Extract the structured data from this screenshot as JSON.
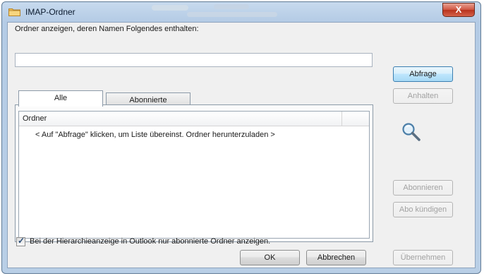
{
  "window": {
    "title": "IMAP-Ordner",
    "close_label": "X"
  },
  "filter": {
    "label": "Ordner anzeigen, deren Namen Folgendes enthalten:",
    "value": "",
    "placeholder": ""
  },
  "tabs": [
    {
      "label": "Alle",
      "active": true
    },
    {
      "label": "Abonnierte",
      "active": false
    }
  ],
  "list": {
    "column_header": "Ordner",
    "empty_message": "< Auf \"Abfrage\" klicken, um Liste übereinst. Ordner herunterzuladen >"
  },
  "side_buttons": {
    "query": "Abfrage",
    "stop": "Anhalten",
    "subscribe": "Abonnieren",
    "unsubscribe": "Abo kündigen"
  },
  "hierarchy_option": {
    "label": "Bei der Hierarchieanzeige in Outlook nur abonnierte Ordner anzeigen.",
    "checked": true
  },
  "footer_buttons": {
    "ok": "OK",
    "cancel": "Abbrechen",
    "apply": "Übernehmen"
  },
  "icons": {
    "title": "folder-icon",
    "search": "magnifier-icon"
  },
  "colors": {
    "title_bar": "#b9cfe6",
    "dialog_bg": "#f0f0f0",
    "close_button": "#cf5440",
    "default_button_border": "#3c7fb1"
  }
}
